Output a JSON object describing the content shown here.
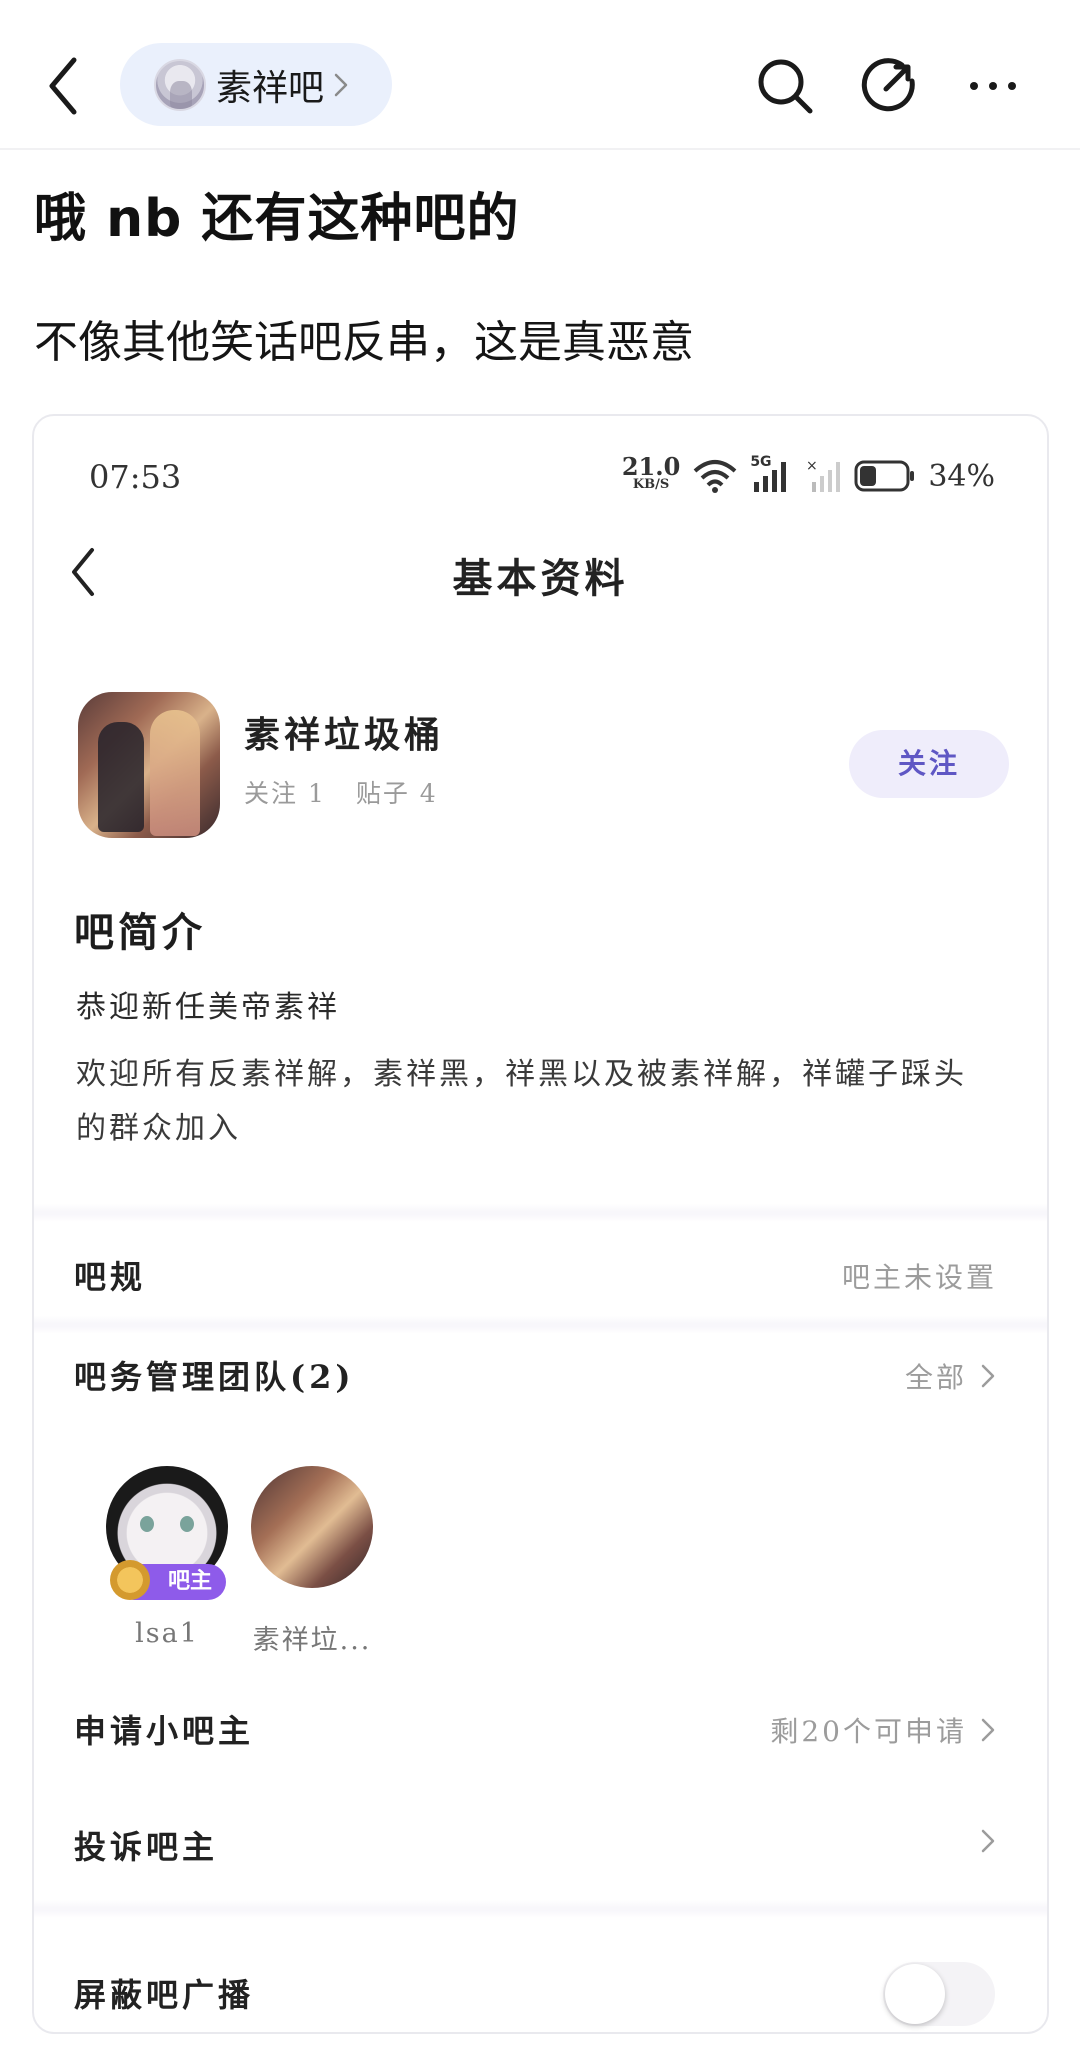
{
  "topbar": {
    "forum_name": "素祥吧",
    "icons": [
      "back-arrow-icon",
      "forum-avatar",
      "chevron-right-icon",
      "search-icon",
      "share-icon",
      "more-icon"
    ]
  },
  "post": {
    "title": "哦 nb 还有这种吧的",
    "body": "不像其他笑话吧反串，这是真恶意"
  },
  "screenshot": {
    "status_bar": {
      "time": "07:53",
      "net_speed": "21.0",
      "net_unit": "KB/S",
      "network": "5G",
      "battery": "34%"
    },
    "page_title": "基本资料",
    "profile": {
      "name": "素祥垃圾桶",
      "follow_count": "关注 1",
      "post_count": "贴子 4",
      "follow_button": "关注"
    },
    "intro": {
      "heading": "吧简介",
      "motto": "恭迎新任美帝素祥",
      "description": "欢迎所有反素祥解，素祥黑，祥黑以及被素祥解，祥罐子踩头的群众加入"
    },
    "rules": {
      "label": "吧规",
      "value": "吧主未设置"
    },
    "team": {
      "label": "吧务管理团队(2)",
      "all": "全部",
      "members": [
        {
          "name": "lsa1",
          "badge": "吧主"
        },
        {
          "name": "素祥垃..."
        }
      ]
    },
    "apply": {
      "label": "申请小吧主",
      "value": "剩20个可申请"
    },
    "complain": {
      "label": "投诉吧主"
    },
    "block": {
      "label": "屏蔽吧广播",
      "toggle_on": false
    }
  },
  "colors": {
    "pill_bg": "#eaf0fc",
    "follow_text": "#5f57c4",
    "badge": "#8e5bea"
  }
}
